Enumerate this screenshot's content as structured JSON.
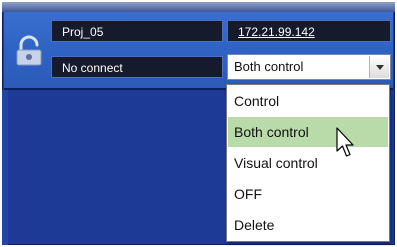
{
  "device": {
    "name": "Proj_05",
    "ip": "172.21.99.142",
    "status": "No connect"
  },
  "control_select": {
    "selected": "Both control",
    "options": [
      "Control",
      "Both control",
      "Visual control",
      "OFF",
      "Delete"
    ],
    "highlighted_index": 1
  },
  "colors": {
    "panel_blue": "#2f63c3",
    "background_blue": "#1d3a97",
    "field_dark": "#151a2c",
    "highlight_green": "#b8dba9"
  },
  "icons": [
    "lock-icon",
    "chevron-down-icon",
    "mouse-cursor-icon"
  ]
}
